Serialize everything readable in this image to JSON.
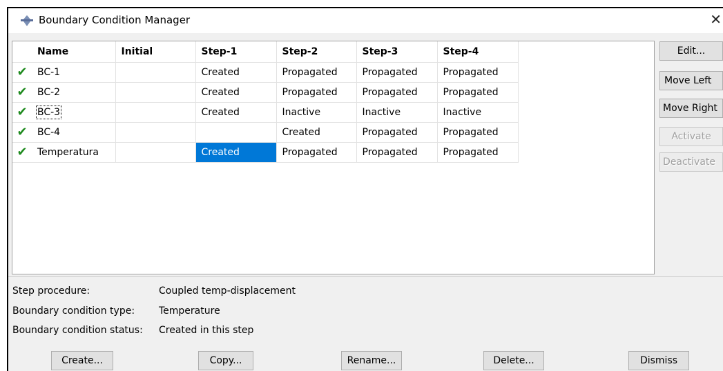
{
  "window": {
    "title": "Boundary Condition Manager",
    "close_glyph": "✕",
    "icon": "abaqus-app-icon"
  },
  "table": {
    "headers": [
      "Name",
      "Initial",
      "Step-1",
      "Step-2",
      "Step-3",
      "Step-4"
    ],
    "rows": [
      {
        "checked": true,
        "name": "BC-1",
        "initial": "",
        "step1": "Created",
        "step2": "Propagated",
        "step3": "Propagated",
        "step4": "Propagated"
      },
      {
        "checked": true,
        "name": "BC-2",
        "initial": "",
        "step1": "Created",
        "step2": "Propagated",
        "step3": "Propagated",
        "step4": "Propagated"
      },
      {
        "checked": true,
        "name": "BC-3",
        "initial": "",
        "step1": "Created",
        "step2": "Inactive",
        "step3": "Inactive",
        "step4": "Inactive"
      },
      {
        "checked": true,
        "name": "BC-4",
        "initial": "",
        "step1": "",
        "step2": "Created",
        "step3": "Propagated",
        "step4": "Propagated"
      },
      {
        "checked": true,
        "name": "Temperatura",
        "initial": "",
        "step1": "Created",
        "step2": "Propagated",
        "step3": "Propagated",
        "step4": "Propagated"
      }
    ],
    "check_glyph": "✔",
    "selected_cell": "Temperatura / Step-1",
    "selection_color": "#0078d7"
  },
  "side_buttons": {
    "edit": "Edit...",
    "move_left": "Move Left",
    "move_right": "Move Right",
    "activate": "Activate",
    "deactivate": "Deactivate"
  },
  "info": {
    "procedure_label": "Step procedure:",
    "procedure_value": "Coupled temp-displacement",
    "type_label": "Boundary condition type:",
    "type_value": "Temperature",
    "status_label": "Boundary condition status:",
    "status_value": "Created in this step"
  },
  "bottom_buttons": {
    "create": "Create...",
    "copy": "Copy...",
    "rename": "Rename...",
    "delete": "Delete...",
    "dismiss": "Dismiss"
  }
}
